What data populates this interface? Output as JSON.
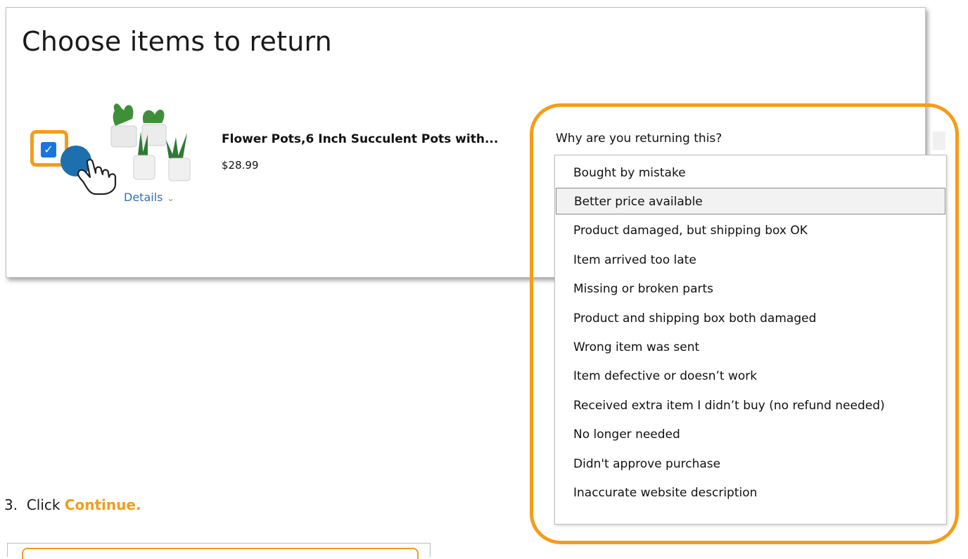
{
  "card": {
    "title": "Choose items to return"
  },
  "item": {
    "checked": true,
    "name": "Flower Pots,6 Inch Succulent Pots with...",
    "price": "$28.99",
    "details_label": "Details"
  },
  "return_reason": {
    "prompt": "Why are you returning this?",
    "selected": "Better price available",
    "options": [
      "Bought by mistake",
      "Better price available",
      "Product damaged, but shipping box OK",
      "Item arrived too late",
      "Missing or broken parts",
      "Product and shipping box both damaged",
      "Wrong item was sent",
      "Item defective or doesn’t work",
      "Received extra item I didn’t buy (no refund needed)",
      "No longer needed",
      "Didn't approve purchase",
      "Inaccurate website description"
    ]
  },
  "instruction": {
    "number": "3.",
    "text": "Click",
    "emphasis": "Continue."
  },
  "colors": {
    "highlight": "#f59c1a",
    "link": "#2f6fb3",
    "checkbox": "#1976e0",
    "pointer": "#1e6fae"
  },
  "icons": [
    "check-icon",
    "hand-pointer-icon",
    "chevron-down-icon"
  ]
}
